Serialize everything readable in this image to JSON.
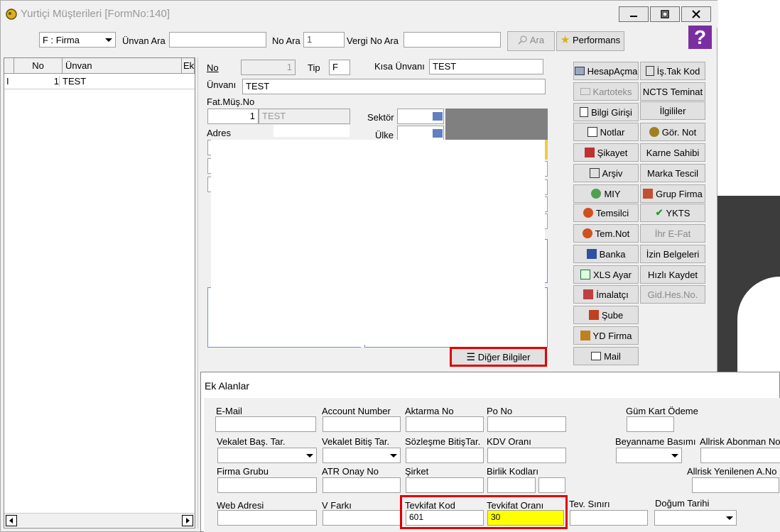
{
  "window": {
    "title": "Yurtiçi Müşterileri [FormNo:140]"
  },
  "search": {
    "type_value": "F : Firma",
    "unvan_label": "Ünvan Ara",
    "unvan_value": "",
    "no_label": "No Ara",
    "no_value": "1",
    "vergi_label": "Vergi No Ara",
    "vergi_value": "",
    "ara_label": "Ara",
    "performans_label": "Performans"
  },
  "grid": {
    "columns": [
      "No",
      "Ünvan",
      "Ek"
    ],
    "rows": [
      {
        "marker": "I",
        "no": "1",
        "unvan": "TEST"
      }
    ]
  },
  "form": {
    "no_label": "No",
    "no_value": "1",
    "tip_label": "Tip",
    "tip_value": "F",
    "kisa_label": "Kısa Ünvanı",
    "kisa_value": "TEST",
    "unvan_label": "Ünvanı",
    "unvan_value": "TEST",
    "fatmus_label": "Fat.Müş.No",
    "fatmus_value": "1",
    "fatmus_name": "TEST",
    "sektor_label": "Sektör",
    "adres_label": "Adres",
    "ulke_label": "Ülke",
    "diger_label": "Diğer Bilgiler"
  },
  "side_left": [
    "HesapAçma",
    "Kartoteks",
    "Bilgi Girişi",
    "Notlar",
    "Şikayet",
    "Arşiv",
    "MIY",
    "Temsilci",
    "Tem.Not",
    "Banka",
    "XLS Ayar",
    "İmalatçı",
    "Şube",
    "YD Firma",
    "Mail"
  ],
  "side_right": [
    "İş.Tak Kod",
    "NCTS Teminat",
    "İlgililer",
    "Gör. Not",
    "Karne Sahibi",
    "Marka Tescil",
    "Grup Firma",
    "YKTS",
    "İhr E-Fat",
    "İzin Belgeleri",
    "Hızlı Kaydet",
    "Gid.Hes.No."
  ],
  "ek_alanlar": {
    "title": "Ek Alanlar",
    "email": "E-Mail",
    "account": "Account Number",
    "aktarma": "Aktarma No",
    "pono": "Po No",
    "gumkart": "Güm Kart Ödeme",
    "vekbas": "Vekalet Baş. Tar.",
    "vekbit": "Vekalet Bitiş Tar.",
    "sozbit": "Sözleşme BitişTar.",
    "kdv": "KDV Oranı",
    "beyanname": "Beyanname Basımı",
    "allrisk_abone": "Allrisk Abonman No",
    "firmagrubu": "Firma Grubu",
    "atr": "ATR Onay No",
    "sirket": "Şirket",
    "birlik": "Birlik Kodları",
    "allrisk_yen": "Allrisk Yenilenen A.No",
    "web": "Web Adresi",
    "vfarki": "V Farkı",
    "tevkod_label": "Tevkifat Kod",
    "tevkod_value": "601",
    "tevoran_label": "Tevkifat Oranı",
    "tevoran_value": "30",
    "tevsinir": "Tev. Sınırı",
    "dogum": "Doğum Tarihi"
  },
  "colors": {
    "highlight_yellow": "#ffff00",
    "red_box": "#e00000",
    "dark_panel": "#808080"
  }
}
